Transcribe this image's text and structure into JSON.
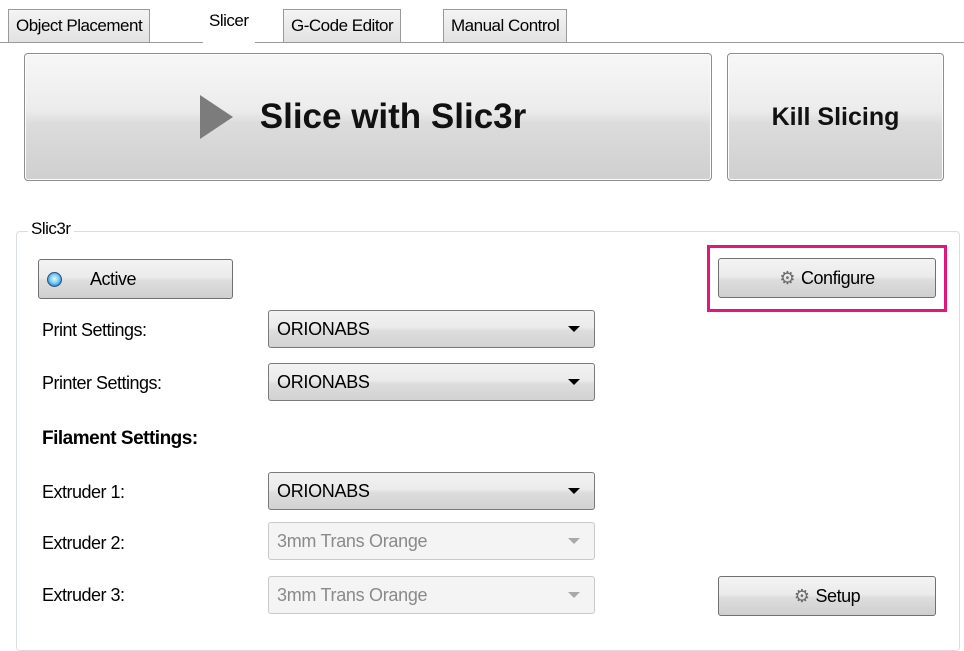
{
  "tabs": [
    {
      "label": "Object Placement",
      "active": false
    },
    {
      "label": "Slicer",
      "active": true
    },
    {
      "label": "G-Code Editor",
      "active": false
    },
    {
      "label": "Manual Control",
      "active": false
    }
  ],
  "slice_button": {
    "label": "Slice with Slic3r",
    "icon": "play-icon"
  },
  "kill_button": {
    "label": "Kill Slicing"
  },
  "slic3r_group": {
    "title": "Slic3r",
    "active_button": {
      "label": "Active",
      "icon": "radio-indicator-icon"
    },
    "configure_button": {
      "label": "Configure",
      "icon": "gear-icon"
    },
    "print_settings": {
      "label": "Print Settings:",
      "value": "ORIONABS"
    },
    "printer_settings": {
      "label": "Printer Settings:",
      "value": "ORIONABS"
    },
    "filament_heading": "Filament Settings:",
    "extruders": [
      {
        "label": "Extruder 1:",
        "value": "ORIONABS",
        "enabled": true
      },
      {
        "label": "Extruder 2:",
        "value": "3mm Trans Orange",
        "enabled": false
      },
      {
        "label": "Extruder 3:",
        "value": "3mm Trans Orange",
        "enabled": false
      }
    ],
    "setup_button": {
      "label": "Setup",
      "icon": "gears-icon"
    }
  },
  "colors": {
    "highlight": "#e4157c",
    "active_indicator": "#2a8bd0"
  }
}
